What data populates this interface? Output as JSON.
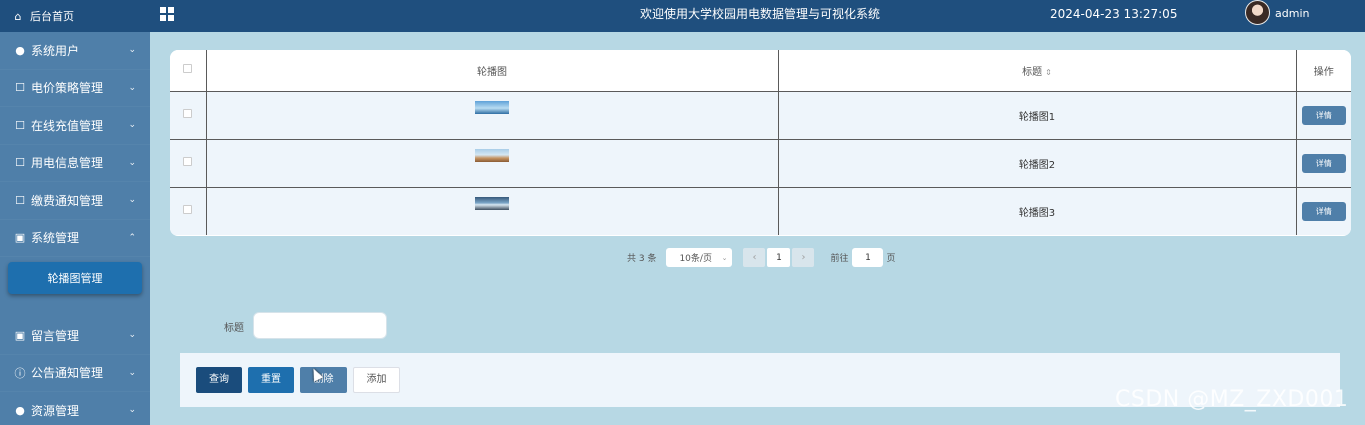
{
  "sidebar": {
    "home_label": "后台首页",
    "items": [
      {
        "label": "系统用户",
        "icon": "user-icon",
        "expanded": false
      },
      {
        "label": "电价策略管理",
        "icon": "clipboard-icon",
        "expanded": false
      },
      {
        "label": "在线充值管理",
        "icon": "clipboard-icon",
        "expanded": false
      },
      {
        "label": "用电信息管理",
        "icon": "clipboard-icon",
        "expanded": false
      },
      {
        "label": "缴费通知管理",
        "icon": "clipboard-icon",
        "expanded": false
      },
      {
        "label": "系统管理",
        "icon": "image-icon",
        "expanded": true
      },
      {
        "label": "留言管理",
        "icon": "image-icon",
        "expanded": false
      },
      {
        "label": "公告通知管理",
        "icon": "info-icon",
        "expanded": false
      },
      {
        "label": "资源管理",
        "icon": "location-icon",
        "expanded": false
      }
    ],
    "active_subitem": "轮播图管理"
  },
  "header": {
    "title": "欢迎使用大学校园用电数据管理与可视化系统",
    "datetime": "2024-04-23 13:27:05",
    "username": "admin"
  },
  "table": {
    "columns": [
      "轮播图",
      "标题",
      "操作"
    ],
    "rows": [
      {
        "title": "轮播图1",
        "action": "详情"
      },
      {
        "title": "轮播图2",
        "action": "详情"
      },
      {
        "title": "轮播图3",
        "action": "详情"
      }
    ]
  },
  "pagination": {
    "total": "共 3 条",
    "page_size": "10条/页",
    "current_page": "1",
    "goto_prefix": "前往",
    "goto_value": "1",
    "goto_suffix": "页"
  },
  "search": {
    "label": "标题",
    "value": ""
  },
  "actions": {
    "query": "查询",
    "reset": "重置",
    "delete": "删除",
    "add": "添加"
  },
  "watermark": "CSDN @MZ_ZXD001"
}
